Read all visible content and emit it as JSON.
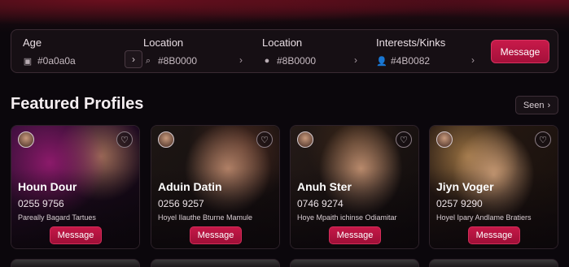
{
  "filters": [
    {
      "label": "Age",
      "value": "#0a0a0a",
      "icon": "calendar-icon"
    },
    {
      "label": "Location",
      "value": "#8B0000",
      "icon": "search-icon"
    },
    {
      "label": "Location",
      "value": "#8B0000",
      "icon": "map-pin-icon"
    },
    {
      "label": "Interests/Kinks",
      "value": "#4B0082",
      "icon": "people-icon"
    }
  ],
  "top_message_label": "Message",
  "section_title": "Featured Profiles",
  "see_label": "Seen",
  "profiles": [
    {
      "name": "Houn Dour",
      "phone": "0255 9756",
      "tagline": "Pareally Bagard Tartues",
      "button": "Message"
    },
    {
      "name": "Aduin Datin",
      "phone": "0256 9257",
      "tagline": "Hoyel Ilauthe Bturne Mamule",
      "button": "Message"
    },
    {
      "name": "Anuh Ster",
      "phone": "0746 9274",
      "tagline": "Hoye Mpaith ichinse Odiamitar",
      "button": "Message"
    },
    {
      "name": "Jiyn Voger",
      "phone": "0257 9290",
      "tagline": "Hoyel Ipary Andlame Bratiers",
      "button": "Message"
    }
  ],
  "colors": {
    "accent": "#c81a4a",
    "background": "#0b070c"
  }
}
